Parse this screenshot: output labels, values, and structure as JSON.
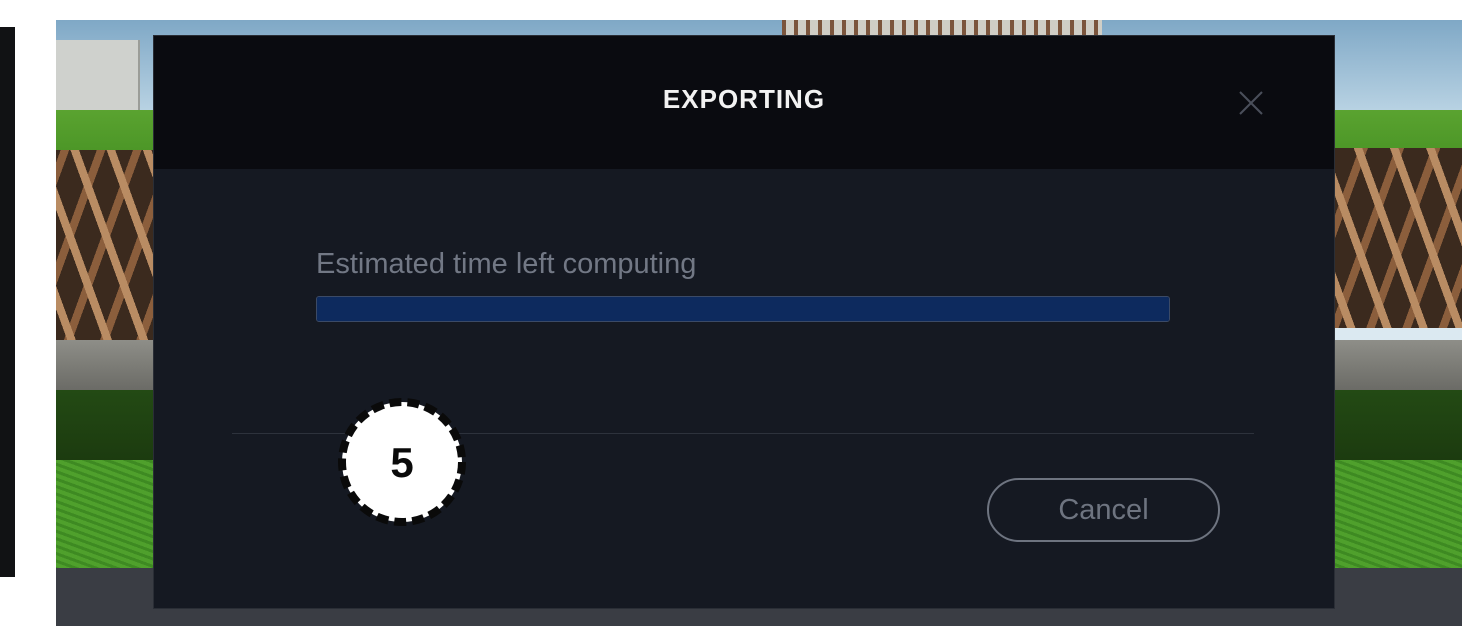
{
  "dialog": {
    "title": "EXPORTING",
    "status_text": "Estimated time left computing",
    "progress": 1.0,
    "cancel_label": "Cancel",
    "close_icon": "close-icon"
  },
  "annotation": {
    "step_number": "5"
  },
  "colors": {
    "modal_bg": "#151922",
    "header_bg": "#0a0b10",
    "progress_fill": "#0d2a5e",
    "badge_bg": "#ffffff"
  }
}
